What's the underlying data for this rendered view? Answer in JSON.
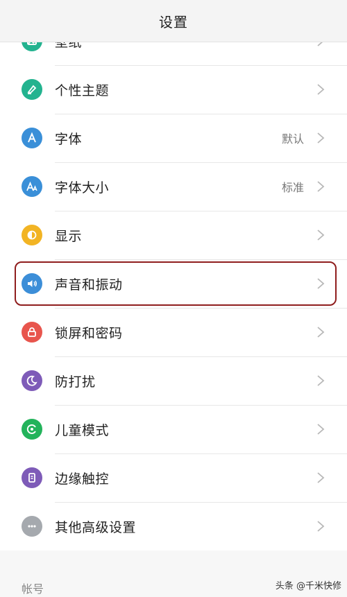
{
  "header": {
    "title": "设置"
  },
  "settings": [
    {
      "label": "壁纸",
      "value": "",
      "icon": "wallpaper-icon",
      "color": "#23b38f"
    },
    {
      "label": "个性主题",
      "value": "",
      "icon": "theme-brush-icon",
      "color": "#23b38f"
    },
    {
      "label": "字体",
      "value": "默认",
      "icon": "font-icon",
      "color": "#3a8fd8"
    },
    {
      "label": "字体大小",
      "value": "标准",
      "icon": "font-size-icon",
      "color": "#3a8fd8"
    },
    {
      "label": "显示",
      "value": "",
      "icon": "display-brightness-icon",
      "color": "#f2b424"
    },
    {
      "label": "声音和振动",
      "value": "",
      "icon": "sound-icon",
      "color": "#3c8ed8"
    },
    {
      "label": "锁屏和密码",
      "value": "",
      "icon": "lock-icon",
      "color": "#e8554d"
    },
    {
      "label": "防打扰",
      "value": "",
      "icon": "moon-icon",
      "color": "#7e5bb8"
    },
    {
      "label": "儿童模式",
      "value": "",
      "icon": "kids-mode-icon",
      "color": "#23b35b"
    },
    {
      "label": "边缘触控",
      "value": "",
      "icon": "edge-touch-icon",
      "color": "#7e5bb8"
    },
    {
      "label": "其他高级设置",
      "value": "",
      "icon": "more-icon",
      "color": "#a5a9ae"
    }
  ],
  "section": {
    "account_label": "帐号"
  },
  "watermark": "头条 @千米快修"
}
